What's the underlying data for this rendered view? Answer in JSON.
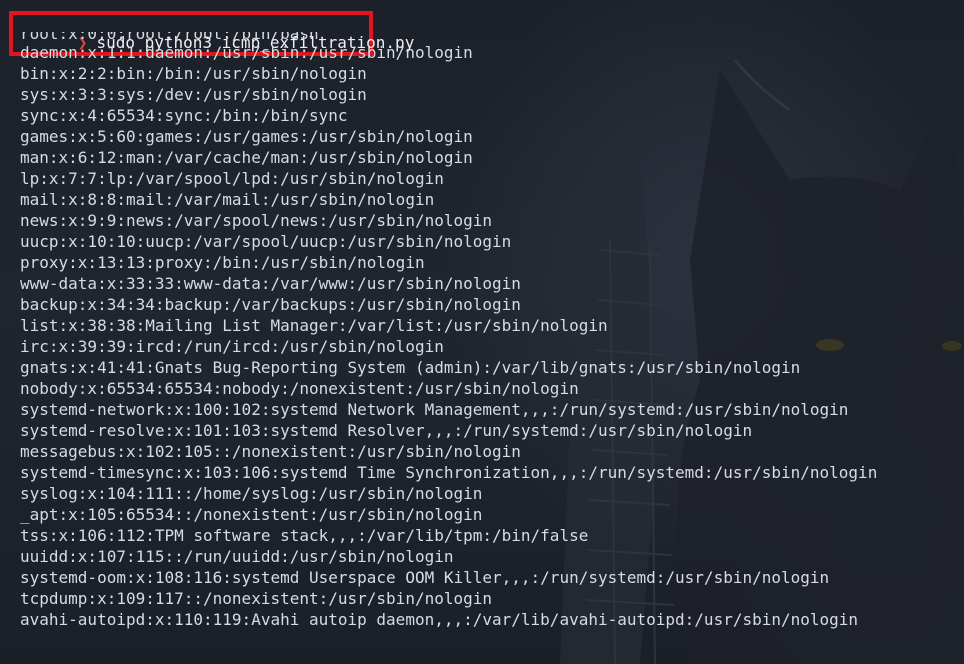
{
  "terminal": {
    "prompt_symbol": "❯",
    "command": "sudo python3 icmp_exfiltration.py",
    "output_lines": [
      "root:x:0:0:root:/root:/bin/bash",
      "daemon:x:1:1:daemon:/usr/sbin:/usr/sbin/nologin",
      "bin:x:2:2:bin:/bin:/usr/sbin/nologin",
      "sys:x:3:3:sys:/dev:/usr/sbin/nologin",
      "sync:x:4:65534:sync:/bin:/bin/sync",
      "games:x:5:60:games:/usr/games:/usr/sbin/nologin",
      "man:x:6:12:man:/var/cache/man:/usr/sbin/nologin",
      "lp:x:7:7:lp:/var/spool/lpd:/usr/sbin/nologin",
      "mail:x:8:8:mail:/var/mail:/usr/sbin/nologin",
      "news:x:9:9:news:/var/spool/news:/usr/sbin/nologin",
      "uucp:x:10:10:uucp:/var/spool/uucp:/usr/sbin/nologin",
      "proxy:x:13:13:proxy:/bin:/usr/sbin/nologin",
      "www-data:x:33:33:www-data:/var/www:/usr/sbin/nologin",
      "backup:x:34:34:backup:/var/backups:/usr/sbin/nologin",
      "list:x:38:38:Mailing List Manager:/var/list:/usr/sbin/nologin",
      "irc:x:39:39:ircd:/run/ircd:/usr/sbin/nologin",
      "gnats:x:41:41:Gnats Bug-Reporting System (admin):/var/lib/gnats:/usr/sbin/nologin",
      "nobody:x:65534:65534:nobody:/nonexistent:/usr/sbin/nologin",
      "systemd-network:x:100:102:systemd Network Management,,,:/run/systemd:/usr/sbin/nologin",
      "systemd-resolve:x:101:103:systemd Resolver,,,:/run/systemd:/usr/sbin/nologin",
      "messagebus:x:102:105::/nonexistent:/usr/sbin/nologin",
      "systemd-timesync:x:103:106:systemd Time Synchronization,,,:/run/systemd:/usr/sbin/nologin",
      "syslog:x:104:111::/home/syslog:/usr/sbin/nologin",
      "_apt:x:105:65534::/nonexistent:/usr/sbin/nologin",
      "tss:x:106:112:TPM software stack,,,:/var/lib/tpm:/bin/false",
      "uuidd:x:107:115::/run/uuidd:/usr/sbin/nologin",
      "systemd-oom:x:108:116:systemd Userspace OOM Killer,,,:/run/systemd:/usr/sbin/nologin",
      "tcpdump:x:109:117::/nonexistent:/usr/sbin/nologin",
      "avahi-autoipd:x:110:119:Avahi autoip daemon,,,:/var/lib/avahi-autoipd:/usr/sbin/nologin"
    ]
  },
  "colors": {
    "background": "#1f232d",
    "text": "#d7dbe2",
    "prompt_arrow": "#e0433a",
    "highlight_border": "#e3141d"
  }
}
